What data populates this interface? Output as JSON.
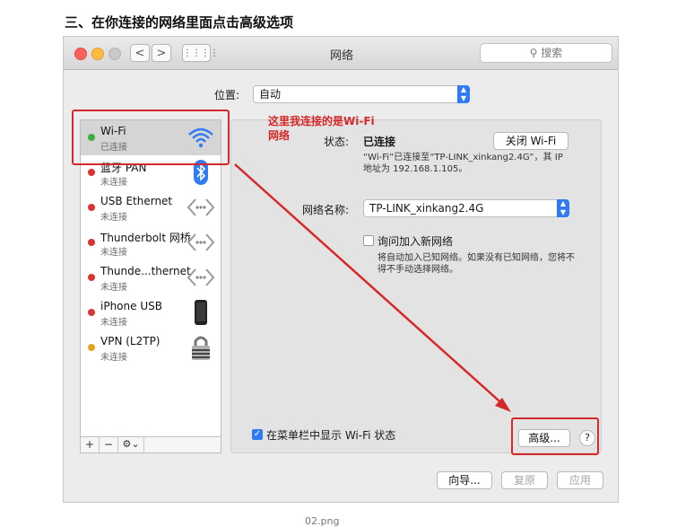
{
  "heading": "三、在你连接的网络里面点击高级选项",
  "window": {
    "title": "网络",
    "search_placeholder": "搜索",
    "nav_back": "<",
    "nav_forward": ">",
    "grid": "⋮⋮⋮⋮"
  },
  "location": {
    "label": "位置:",
    "value": "自动"
  },
  "sidebar": {
    "items": [
      {
        "name": "Wi-Fi",
        "status": "已连接",
        "dot_color": "#3cb043",
        "icon": "wifi-icon"
      },
      {
        "name": "蓝牙 PAN",
        "status": "未连接",
        "dot_color": "#d93434",
        "icon": "bluetooth-icon"
      },
      {
        "name": "USB Ethernet",
        "status": "未连接",
        "dot_color": "#d93434",
        "icon": "ethernet-icon"
      },
      {
        "name": "Thunderbolt 网桥",
        "status": "未连接",
        "dot_color": "#d93434",
        "icon": "ethernet-icon"
      },
      {
        "name": "Thunde...thernet",
        "status": "未连接",
        "dot_color": "#d93434",
        "icon": "ethernet-icon"
      },
      {
        "name": "iPhone USB",
        "status": "未连接",
        "dot_color": "#d93434",
        "icon": "iphone-icon"
      },
      {
        "name": "VPN (L2TP)",
        "status": "未连接",
        "dot_color": "#e6a21d",
        "icon": "lock-icon"
      }
    ],
    "add": "+",
    "remove": "−",
    "gear": "⚙︎⌄"
  },
  "annotation": {
    "line1": "这里我连接的是Wi-Fi",
    "line2": "网络"
  },
  "detail": {
    "status_label": "状态:",
    "status_value": "已连接",
    "turn_off_button": "关闭 Wi-Fi",
    "status_desc_line1": "“Wi-Fi”已连接至“TP-LINK_xinkang2.4G”，其 IP",
    "status_desc_line2": "地址为 192.168.1.105。",
    "network_name_label": "网络名称:",
    "network_name_value": "TP-LINK_xinkang2.4G",
    "ask_join_label": "询问加入新网络",
    "ask_join_desc_line1": "将自动加入已知网络。如果没有已知网络，您将不",
    "ask_join_desc_line2": "得不手动选择网络。",
    "show_in_menubar_label": "在菜单栏中显示 Wi-Fi 状态",
    "show_in_menubar_checked": true,
    "advanced_button": "高级...",
    "help_button": "?"
  },
  "footer": {
    "assistant_button": "向导...",
    "revert_button": "复原",
    "apply_button": "应用"
  },
  "caption": "02.png"
}
